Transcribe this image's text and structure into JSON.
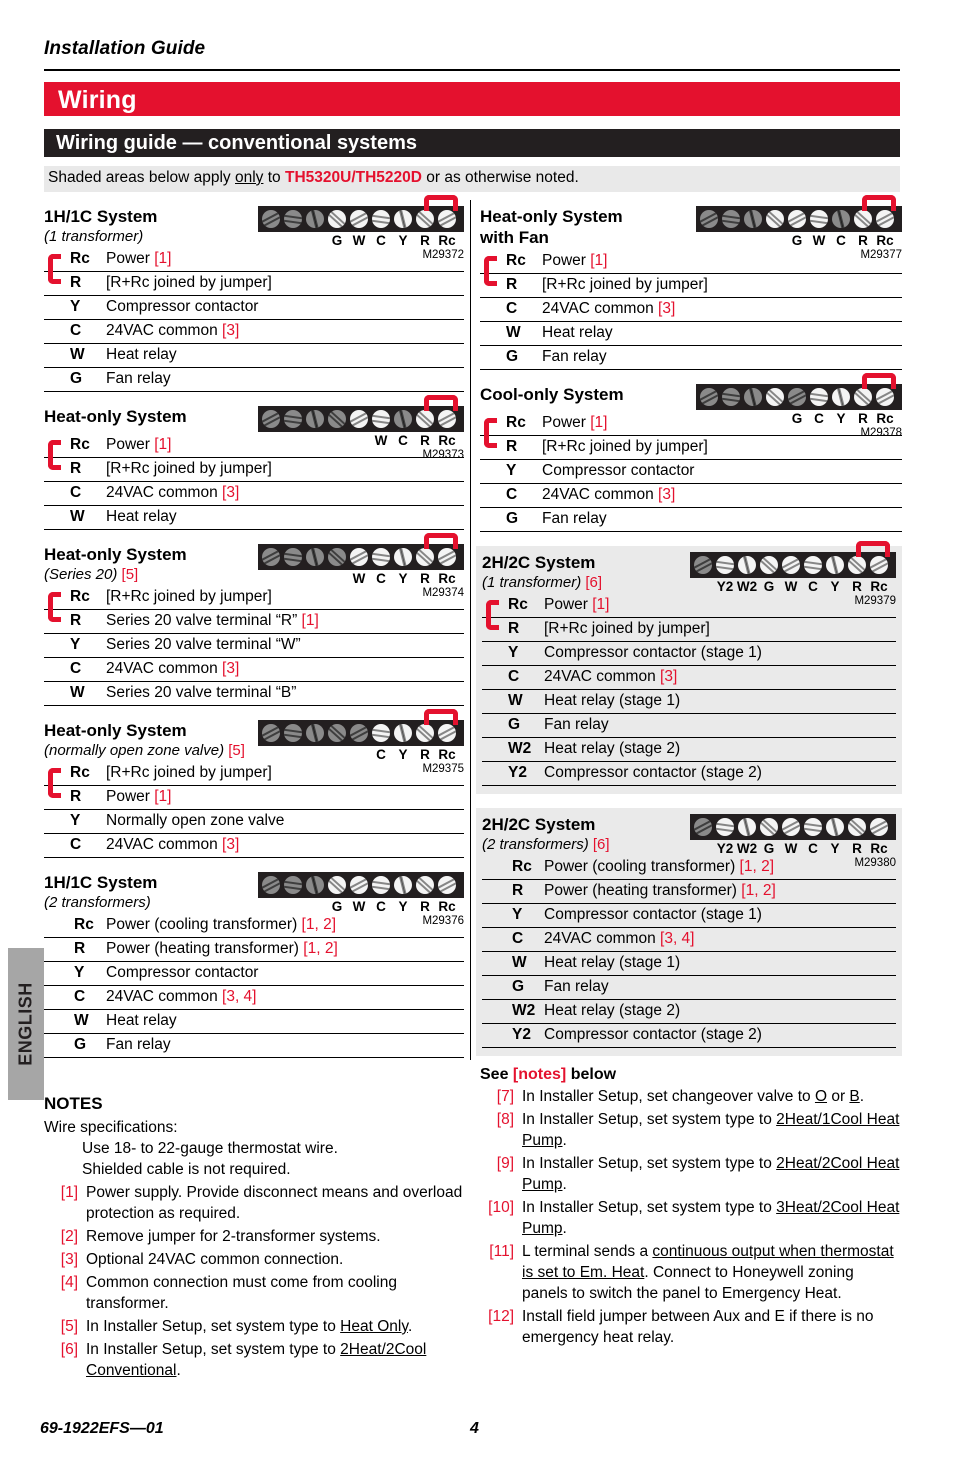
{
  "header": {
    "guide_label": "Installation Guide",
    "section_title": "Wiring",
    "subsection_title": "Wiring guide — conventional systems",
    "shade_note_pre": "Shaded areas below apply ",
    "shade_note_only": "only",
    "shade_note_mid": " to ",
    "shade_note_model": "TH5320U/TH5220D",
    "shade_note_post": " or as otherwise noted.",
    "accent_red": "#e4112e",
    "bar_black": "#231f20",
    "shade_gray": "#eaeaea"
  },
  "left_column": {
    "blocks": [
      {
        "title": "1H/1C System",
        "subtitle": "(1 transformer)",
        "subtitle_ref": "",
        "shaded": false,
        "jumper_bracket": true,
        "strip": {
          "code": "M29372",
          "jumper": true,
          "labels": [
            "G",
            "W",
            "C",
            "Y",
            "R",
            "Rc"
          ],
          "active": [
            false,
            false,
            false,
            true,
            true,
            true,
            true,
            true,
            true
          ]
        },
        "rows": [
          {
            "term": "Rc",
            "desc": "Power ",
            "ref": "[1]"
          },
          {
            "term": "R",
            "desc": "[R+Rc joined by jumper]",
            "ref": ""
          },
          {
            "term": "Y",
            "desc": "Compressor contactor",
            "ref": ""
          },
          {
            "term": "C",
            "desc": "24VAC common ",
            "ref": "[3]"
          },
          {
            "term": "W",
            "desc": "Heat relay",
            "ref": ""
          },
          {
            "term": "G",
            "desc": "Fan relay",
            "ref": ""
          }
        ]
      },
      {
        "title": "Heat-only System",
        "subtitle": "",
        "subtitle_ref": "",
        "shaded": false,
        "jumper_bracket": true,
        "strip": {
          "code": "M29373",
          "jumper": true,
          "labels": [
            "W",
            "C",
            "R",
            "Rc"
          ],
          "active": [
            false,
            false,
            false,
            false,
            true,
            true,
            false,
            true,
            true
          ]
        },
        "rows": [
          {
            "term": "Rc",
            "desc": "Power ",
            "ref": "[1]"
          },
          {
            "term": "R",
            "desc": "[R+Rc joined by jumper]",
            "ref": ""
          },
          {
            "term": "C",
            "desc": "24VAC common ",
            "ref": "[3]"
          },
          {
            "term": "W",
            "desc": "Heat relay",
            "ref": ""
          }
        ]
      },
      {
        "title": "Heat-only System",
        "subtitle": "(Series 20) ",
        "subtitle_ref": "[5]",
        "shaded": false,
        "jumper_bracket": true,
        "strip": {
          "code": "M29374",
          "jumper": true,
          "labels": [
            "W",
            "C",
            "Y",
            "R",
            "Rc"
          ],
          "active": [
            false,
            false,
            false,
            false,
            true,
            true,
            true,
            true,
            true
          ]
        },
        "rows": [
          {
            "term": "Rc",
            "desc": "[R+Rc joined by jumper]",
            "ref": ""
          },
          {
            "term": "R",
            "desc": "Series 20 valve terminal “R” ",
            "ref": "[1]"
          },
          {
            "term": "Y",
            "desc": "Series 20 valve terminal “W”",
            "ref": ""
          },
          {
            "term": "C",
            "desc": "24VAC common ",
            "ref": "[3]"
          },
          {
            "term": "W",
            "desc": "Series 20 valve terminal “B”",
            "ref": ""
          }
        ]
      },
      {
        "title": "Heat-only System",
        "subtitle": "(normally open zone valve) ",
        "subtitle_ref": "[5]",
        "shaded": false,
        "jumper_bracket": true,
        "strip": {
          "code": "M29375",
          "jumper": true,
          "labels": [
            "C",
            "Y",
            "R",
            "Rc"
          ],
          "active": [
            false,
            false,
            false,
            false,
            false,
            true,
            true,
            true,
            true
          ]
        },
        "rows": [
          {
            "term": "Rc",
            "desc": "[R+Rc joined by jumper]",
            "ref": ""
          },
          {
            "term": "R",
            "desc": "Power ",
            "ref": "[1]"
          },
          {
            "term": "Y",
            "desc": "Normally open zone valve",
            "ref": ""
          },
          {
            "term": "C",
            "desc": "24VAC common ",
            "ref": "[3]"
          }
        ]
      },
      {
        "title": "1H/1C System",
        "subtitle": "(2 transformers)",
        "subtitle_ref": "",
        "shaded": false,
        "jumper_bracket": false,
        "strip": {
          "code": "M29376",
          "jumper": false,
          "labels": [
            "G",
            "W",
            "C",
            "Y",
            "R",
            "Rc"
          ],
          "active": [
            false,
            false,
            false,
            true,
            true,
            true,
            true,
            true,
            true
          ]
        },
        "rows": [
          {
            "term": "Rc",
            "desc": "Power (cooling transformer) ",
            "ref": "[1, 2]"
          },
          {
            "term": "R",
            "desc": "Power (heating transformer) ",
            "ref": "[1, 2]"
          },
          {
            "term": "Y",
            "desc": "Compressor contactor",
            "ref": ""
          },
          {
            "term": "C",
            "desc": "24VAC common ",
            "ref": "[3, 4]"
          },
          {
            "term": "W",
            "desc": "Heat relay",
            "ref": ""
          },
          {
            "term": "G",
            "desc": "Fan relay",
            "ref": ""
          }
        ]
      }
    ]
  },
  "right_column": {
    "blocks": [
      {
        "title": "Heat-only System",
        "title2": "with Fan",
        "subtitle": "",
        "subtitle_ref": "",
        "shaded": false,
        "jumper_bracket": true,
        "strip": {
          "code": "M29377",
          "jumper": true,
          "labels": [
            "G",
            "W",
            "C",
            "R",
            "Rc"
          ],
          "active": [
            false,
            false,
            false,
            true,
            true,
            true,
            false,
            true,
            true
          ]
        },
        "rows": [
          {
            "term": "Rc",
            "desc": "Power ",
            "ref": "[1]"
          },
          {
            "term": "R",
            "desc": "[R+Rc joined by jumper]",
            "ref": ""
          },
          {
            "term": "C",
            "desc": "24VAC common ",
            "ref": "[3]"
          },
          {
            "term": "W",
            "desc": "Heat relay",
            "ref": ""
          },
          {
            "term": "G",
            "desc": "Fan relay",
            "ref": ""
          }
        ]
      },
      {
        "title": "Cool-only System",
        "subtitle": "",
        "subtitle_ref": "",
        "shaded": false,
        "jumper_bracket": true,
        "strip": {
          "code": "M29378",
          "jumper": true,
          "labels": [
            "G",
            "C",
            "Y",
            "R",
            "Rc"
          ],
          "active": [
            false,
            false,
            false,
            true,
            false,
            true,
            true,
            true,
            true
          ]
        },
        "rows": [
          {
            "term": "Rc",
            "desc": "Power ",
            "ref": "[1]"
          },
          {
            "term": "R",
            "desc": "[R+Rc joined by jumper]",
            "ref": ""
          },
          {
            "term": "Y",
            "desc": "Compressor contactor",
            "ref": ""
          },
          {
            "term": "C",
            "desc": "24VAC common ",
            "ref": "[3]"
          },
          {
            "term": "G",
            "desc": "Fan relay",
            "ref": ""
          }
        ]
      },
      {
        "title": "2H/2C System",
        "subtitle": "(1 transformer) ",
        "subtitle_ref": "[6]",
        "shaded": true,
        "jumper_bracket": true,
        "strip": {
          "code": "M29379",
          "jumper": true,
          "labels": [
            "Y2",
            "W2",
            "G",
            "W",
            "C",
            "Y",
            "R",
            "Rc"
          ],
          "active": [
            false,
            true,
            true,
            true,
            true,
            true,
            true,
            true,
            true
          ]
        },
        "rows": [
          {
            "term": "Rc",
            "desc": "Power ",
            "ref": "[1]"
          },
          {
            "term": "R",
            "desc": "[R+Rc joined by jumper]",
            "ref": ""
          },
          {
            "term": "Y",
            "desc": "Compressor contactor (stage 1)",
            "ref": ""
          },
          {
            "term": "C",
            "desc": "24VAC common ",
            "ref": "[3]"
          },
          {
            "term": "W",
            "desc": "Heat relay (stage 1)",
            "ref": ""
          },
          {
            "term": "G",
            "desc": "Fan relay",
            "ref": ""
          },
          {
            "term": "W2",
            "desc": "Heat relay (stage 2)",
            "ref": ""
          },
          {
            "term": "Y2",
            "desc": "Compressor contactor (stage 2)",
            "ref": ""
          }
        ]
      },
      {
        "title": "2H/2C System",
        "subtitle": "(2 transformers) ",
        "subtitle_ref": "[6]",
        "shaded": true,
        "jumper_bracket": false,
        "strip": {
          "code": "M29380",
          "jumper": false,
          "labels": [
            "Y2",
            "W2",
            "G",
            "W",
            "C",
            "Y",
            "R",
            "Rc"
          ],
          "active": [
            false,
            true,
            true,
            true,
            true,
            true,
            true,
            true,
            true
          ]
        },
        "rows": [
          {
            "term": "Rc",
            "desc": "Power (cooling transformer) ",
            "ref": "[1, 2]"
          },
          {
            "term": "R",
            "desc": "Power (heating transformer) ",
            "ref": "[1, 2]"
          },
          {
            "term": "Y",
            "desc": "Compressor contactor (stage 1)",
            "ref": ""
          },
          {
            "term": "C",
            "desc": "24VAC common ",
            "ref": "[3, 4]"
          },
          {
            "term": "W",
            "desc": "Heat relay (stage 1)",
            "ref": ""
          },
          {
            "term": "G",
            "desc": "Fan relay",
            "ref": ""
          },
          {
            "term": "W2",
            "desc": "Heat relay (stage 2)",
            "ref": ""
          },
          {
            "term": "Y2",
            "desc": "Compressor contactor (stage 2)",
            "ref": ""
          }
        ]
      }
    ]
  },
  "notes": {
    "title": "NOTES",
    "wire_spec_label": "Wire specifications:",
    "wire_spec_lines": [
      "Use 18- to 22-gauge thermostat wire.",
      "Shielded cable is not required."
    ],
    "items": [
      {
        "num": "[1]",
        "text": "Power supply. Provide disconnect means and overload protection as required.",
        "underline": ""
      },
      {
        "num": "[2]",
        "text": "Remove jumper for 2-transformer systems.",
        "underline": ""
      },
      {
        "num": "[3]",
        "text": "Optional 24VAC common connection.",
        "underline": ""
      },
      {
        "num": "[4]",
        "text": "Common connection must come from cooling transformer.",
        "underline": ""
      },
      {
        "num": "[5]",
        "text": "In Installer Setup, set system type to ",
        "underline": "Heat Only",
        "tail": "."
      },
      {
        "num": "[6]",
        "text": "In Installer Setup, set system type to ",
        "underline": "2Heat/2Cool Conventional",
        "tail": "."
      }
    ]
  },
  "see_notes": {
    "label_pre": "See ",
    "label_ref": "[notes]",
    "label_post": " below",
    "items": [
      {
        "num": "[7]",
        "text": "In Installer Setup, set changeover valve to ",
        "underline": "O",
        "mid": " or ",
        "underline2": "B",
        "tail": "."
      },
      {
        "num": "[8]",
        "text": "In Installer Setup, set system type to ",
        "underline": "2Heat/1Cool Heat Pump",
        "tail": "."
      },
      {
        "num": "[9]",
        "text": "In Installer Setup, set system type to ",
        "underline": "2Heat/2Cool Heat Pump",
        "tail": "."
      },
      {
        "num": "[10]",
        "text": "In Installer Setup, set system type to ",
        "underline": "3Heat/2Cool Heat Pump",
        "tail": "."
      },
      {
        "num": "[11]",
        "text": "L terminal sends a ",
        "underline": "continuous output when thermostat is set to Em. Heat",
        "tail": ". Connect to Honeywell zoning panels to switch the panel to Emergency Heat."
      },
      {
        "num": "[12]",
        "text": "Install field jumper between Aux and E if there is no emergency heat relay.",
        "underline": "",
        "tail": ""
      }
    ]
  },
  "language_tab": {
    "label": "ENGLISH"
  },
  "footer": {
    "doc_number": "69-1922EFS—01",
    "page_number": "4"
  }
}
